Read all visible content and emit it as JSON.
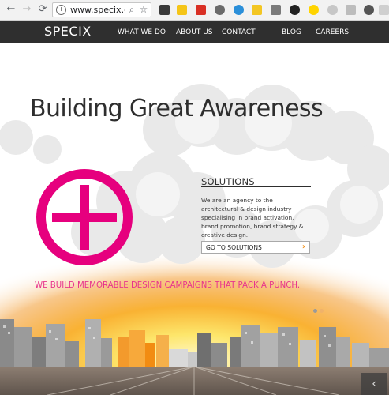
{
  "browser": {
    "url": "www.specix.co",
    "back_icon": "←",
    "forward_icon": "→",
    "reload_icon": "⟳",
    "info_icon": "i",
    "zoom_icon": "⌕",
    "star_icon": "☆"
  },
  "site": {
    "logo": "SPECIX",
    "nav": [
      "WHAT WE DO",
      "ABOUT US",
      "CONTACT",
      "BLOG",
      "CAREERS"
    ]
  },
  "hero": {
    "headline": "Building Great Awareness",
    "solutions": {
      "title": "SOLUTIONS",
      "body": "We are an agency to the architectural & design industry specialising in brand activation, brand promotion, brand strategy & creative design.",
      "cta_label": "GO TO SOLUTIONS",
      "cta_arrow": "›"
    },
    "tagline": "WE BUILD MEMORABLE DESIGN CAMPAIGNS THAT PACK A PUNCH.",
    "slider_prev": "‹"
  },
  "colors": {
    "brand_magenta": "#e6007e",
    "tagline_pink": "#e8358c",
    "accent_orange": "#f28c12",
    "header_dark": "#2f2f2f"
  }
}
